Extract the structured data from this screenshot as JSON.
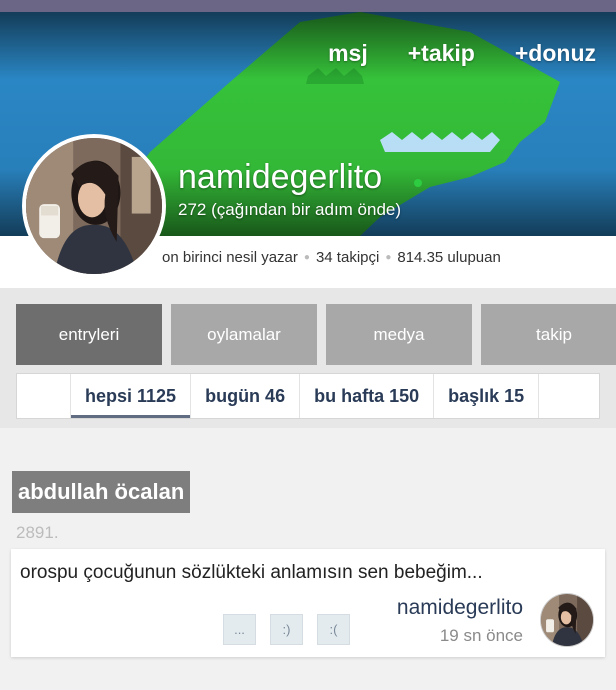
{
  "header": {
    "actions": [
      {
        "label": "msj"
      },
      {
        "label": "+takip"
      },
      {
        "label": "+donuz"
      }
    ]
  },
  "profile": {
    "username": "namidegerlito",
    "karma": "272 (çağından bir adım önde)",
    "stats": [
      "on birinci nesil yazar",
      "34 takipçi",
      "814.35 ulupuan"
    ],
    "online_color": "#2ecc40"
  },
  "tabs": [
    {
      "label": "entryleri",
      "active": true
    },
    {
      "label": "oylamalar",
      "active": false
    },
    {
      "label": "medya",
      "active": false
    },
    {
      "label": "takip",
      "active": false
    }
  ],
  "subtabs": [
    {
      "label": "hepsi 1125",
      "active": true
    },
    {
      "label": "bugün 46",
      "active": false
    },
    {
      "label": "bu hafta 150",
      "active": false
    },
    {
      "label": "başlık 15",
      "active": false
    }
  ],
  "entry": {
    "topic": "abdullah öcalan",
    "number": "2891.",
    "text": "orospu çocuğunun sözlükteki anlamısın sen bebeğim...",
    "votes": [
      "...",
      ":)",
      ":("
    ],
    "author": "namidegerlito",
    "time": "19 sn önce"
  },
  "colors": {
    "cover_blue": "#2a86c4",
    "cover_green": "#36c23a",
    "active_tab": "#6e6e6e",
    "inactive_tab": "#a8a8a8",
    "link_navy": "#2a3b57"
  }
}
